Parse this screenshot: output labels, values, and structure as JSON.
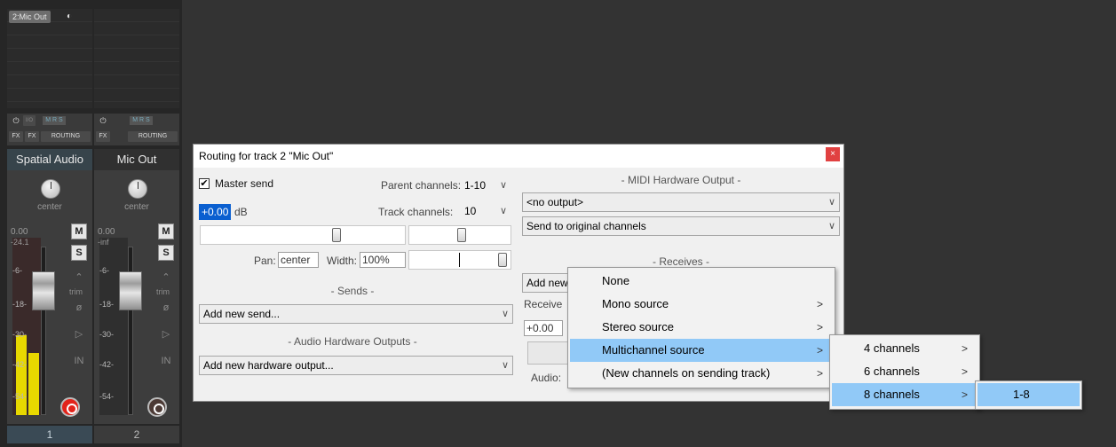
{
  "mixer": {
    "strip1": {
      "name": "Spatial Audio",
      "pan": "center",
      "volume": "0.00",
      "peak": "-24.1",
      "number": "1",
      "fx": "FX",
      "fx2": "FX",
      "routing": "ROUTING",
      "mrs": "M R S",
      "io": "I/O",
      "ticks": [
        "-6-",
        "-18-",
        "-30-",
        "-42-",
        "-54-"
      ],
      "mute": "M",
      "solo": "S",
      "trim": "trim"
    },
    "strip2": {
      "name": "Mic Out",
      "pan": "center",
      "volume": "0.00",
      "peak": "-inf",
      "number": "2",
      "fx": "FX",
      "routing": "ROUTING",
      "mrs": "M R S",
      "tab": "2:Mic Out",
      "ticks": [
        "-6-",
        "-18-",
        "-30-",
        "-42-",
        "-54-"
      ],
      "mute": "M",
      "solo": "S",
      "trim": "trim"
    }
  },
  "dialog": {
    "title": "Routing for track 2 \"Mic Out\"",
    "master_send_label": "Master send",
    "master_send_checked": true,
    "parent_channels_label": "Parent channels:",
    "parent_channels_value": "1-10",
    "volume_value": "+0.00",
    "volume_unit": "dB",
    "track_channels_label": "Track channels:",
    "track_channels_value": "10",
    "pan_label": "Pan:",
    "pan_value": "center",
    "width_label": "Width:",
    "width_value": "100%",
    "sends_title": "- Sends -",
    "add_send": "Add new send...",
    "hw_outputs_title": "- Audio Hardware Outputs -",
    "add_hw_output": "Add new hardware output...",
    "midi_hw_title": "- MIDI Hardware Output -",
    "midi_output": "<no output>",
    "midi_channels": "Send to original channels",
    "receives_title": "- Receives -",
    "add_receive_partial": "Add new",
    "receive_partial": "Receive",
    "receive_vol_partial": "+0.00",
    "audio_partial": "Audio:"
  },
  "menu1": {
    "items": [
      {
        "label": "None",
        "submenu": false
      },
      {
        "label": "Mono source",
        "submenu": true
      },
      {
        "label": "Stereo source",
        "submenu": true
      },
      {
        "label": "Multichannel source",
        "submenu": true,
        "highlighted": true
      },
      {
        "label": "(New channels on sending track)",
        "submenu": true
      }
    ]
  },
  "menu2": {
    "items": [
      {
        "label": "4 channels",
        "submenu": true
      },
      {
        "label": "6 channels",
        "submenu": true
      },
      {
        "label": "8 channels",
        "submenu": true,
        "highlighted": true
      }
    ]
  },
  "menu3": {
    "items": [
      {
        "label": "1-8",
        "highlighted": true
      }
    ]
  },
  "icons": {
    "close": "×",
    "chevron_down": "∨",
    "chevron_right": ">"
  },
  "colors": {
    "highlight": "#91c9f7",
    "close_button": "#e14141",
    "meter": "#e8d800",
    "record_armed": "#e2231a"
  }
}
